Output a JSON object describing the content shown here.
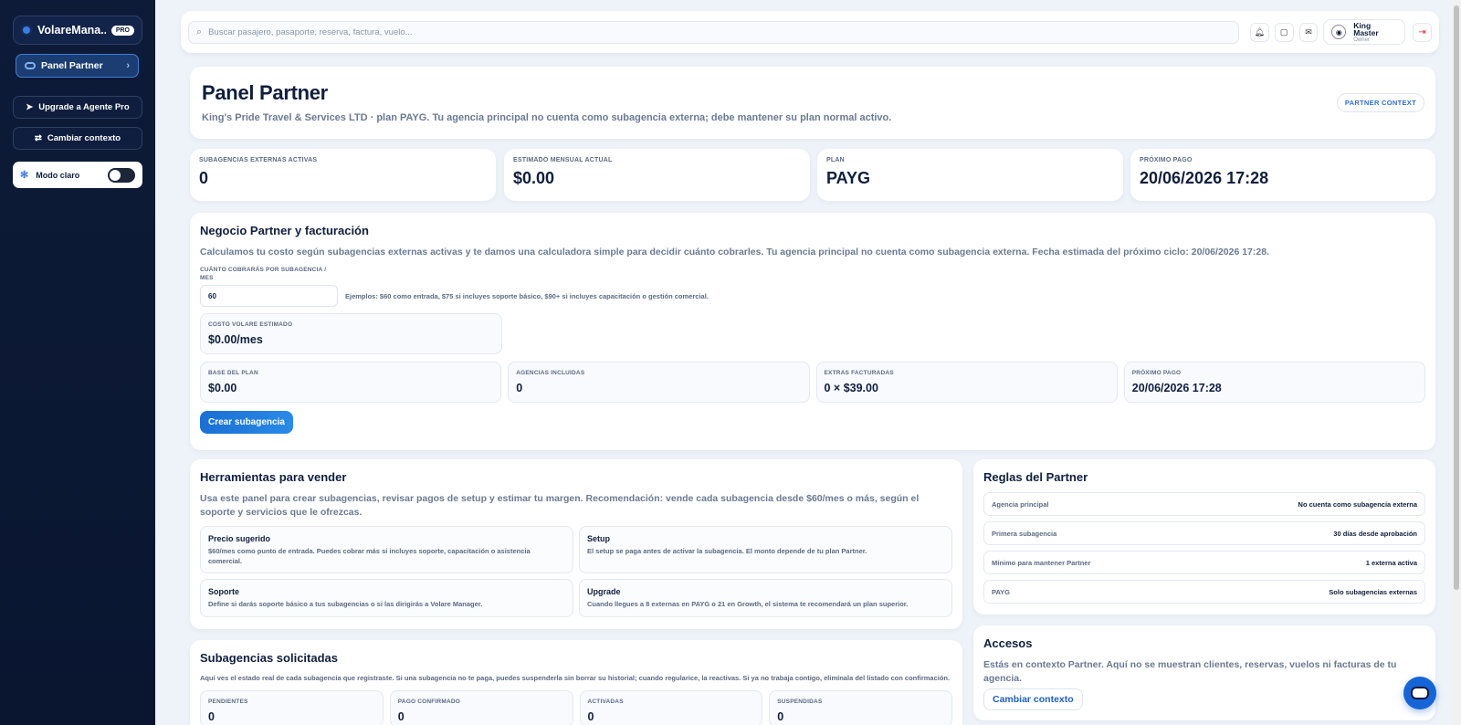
{
  "sidebar": {
    "brand": "VolareMana...",
    "brand_badge": "PRO",
    "active_item": "Panel Partner",
    "upgrade_label": "Upgrade a Agente Pro",
    "context_label": "Cambiar contexto",
    "mode_label": "Modo claro"
  },
  "topbar": {
    "search_placeholder": "Buscar pasajero, pasaporte, reserva, factura, vuelo...",
    "user_name": "King Master",
    "user_role": "Owner"
  },
  "hero": {
    "title": "Panel Partner",
    "subtitle": "King's Pride Travel & Services LTD · plan PAYG. Tu agencia principal no cuenta como subagencia externa; debe mantener su plan normal activo.",
    "pill": "PARTNER CONTEXT"
  },
  "stats": [
    {
      "label": "SUBAGENCIAS EXTERNAS ACTIVAS",
      "value": "0"
    },
    {
      "label": "ESTIMADO MENSUAL ACTUAL",
      "value": "$0.00"
    },
    {
      "label": "PLAN",
      "value": "PAYG"
    },
    {
      "label": "PRÓXIMO PAGO",
      "value": "20/06/2026 17:28"
    }
  ],
  "business": {
    "title": "Negocio Partner y facturación",
    "description": "Calculamos tu costo según subagencias externas activas y te damos una calculadora simple para decidir cuánto cobrarles. Tu agencia principal no cuenta como subagencia externa. Fecha estimada del próximo ciclo: 20/06/2026 17:28.",
    "price_label": "CUÁNTO COBRARÁS POR SUBAGENCIA / MES",
    "price_value": "60",
    "price_hint": "Ejemplos: $60 como entrada, $75 si incluyes soporte básico, $90+ si incluyes capacitación o gestión comercial.",
    "cost_label": "COSTO VOLARE ESTIMADO",
    "cost_value": "$0.00/mes",
    "metrics": [
      {
        "label": "BASE DEL PLAN",
        "value": "$0.00"
      },
      {
        "label": "AGENCIAS INCLUIDAS",
        "value": "0"
      },
      {
        "label": "EXTRAS FACTURADAS",
        "value": "0 × $39.00"
      },
      {
        "label": "PRÓXIMO PAGO",
        "value": "20/06/2026 17:28"
      }
    ],
    "create_button": "Crear subagencia"
  },
  "tools": {
    "title": "Herramientas para vender",
    "description": "Usa este panel para crear subagencias, revisar pagos de setup y estimar tu margen. Recomendación: vende cada subagencia desde $60/mes o más, según el soporte y servicios que le ofrezcas.",
    "items": [
      {
        "title": "Precio sugerido",
        "text": "$60/mes como punto de entrada. Puedes cobrar más si incluyes soporte, capacitación o asistencia comercial."
      },
      {
        "title": "Setup",
        "text": "El setup se paga antes de activar la subagencia. El monto depende de tu plan Partner."
      },
      {
        "title": "Soporte",
        "text": "Define si darás soporte básico a tus subagencias o si las dirigirás a Volare Manager."
      },
      {
        "title": "Upgrade",
        "text": "Cuando llegues a 8 externas en PAYG o 21 en Growth, el sistema te recomendará un plan superior."
      }
    ]
  },
  "rules": {
    "title": "Reglas del Partner",
    "rows": [
      {
        "key": "Agencia principal",
        "value": "No cuenta como subagencia externa"
      },
      {
        "key": "Primera subagencia",
        "value": "30 días desde aprobación"
      },
      {
        "key": "Mínimo para mantener Partner",
        "value": "1 externa activa"
      },
      {
        "key": "PAYG",
        "value": "Solo subagencias externas"
      }
    ]
  },
  "subagencies": {
    "title": "Subagencias solicitadas",
    "description": "Aquí ves el estado real de cada subagencia que registraste. Si una subagencia no te paga, puedes suspenderla sin borrar su historial; cuando regularice, la reactivas. Si ya no trabaja contigo, elimínala del listado con confirmación.",
    "counters": [
      {
        "label": "PENDIENTES",
        "value": "0"
      },
      {
        "label": "PAGO CONFIRMADO",
        "value": "0"
      },
      {
        "label": "ACTIVADAS",
        "value": "0"
      },
      {
        "label": "SUSPENDIDAS",
        "value": "0"
      }
    ]
  },
  "access": {
    "title": "Accesos",
    "description": "Estás en contexto Partner. Aquí no se muestran clientes, reservas, vuelos ni facturas de tu agencia.",
    "button": "Cambiar contexto"
  }
}
